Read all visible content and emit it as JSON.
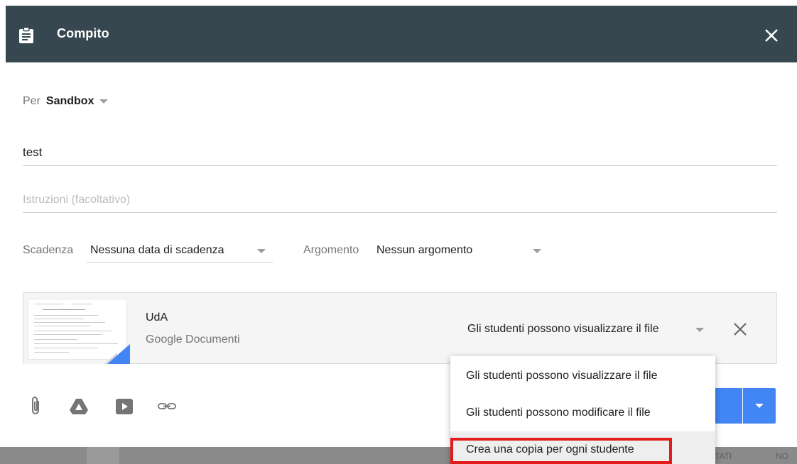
{
  "header": {
    "title": "Compito",
    "bg_color": "#37474f"
  },
  "form": {
    "for_label": "Per",
    "class_name": "Sandbox",
    "title_value": "test",
    "instructions_placeholder": "Istruzioni (facoltativo)",
    "due_label": "Scadenza",
    "due_value": "Nessuna data di scadenza",
    "topic_label": "Argomento",
    "topic_value": "Nessun argomento"
  },
  "attachment": {
    "name": "UdA",
    "type": "Google Documenti",
    "permission": "Gli studenti possono visualizzare il file"
  },
  "toolbar": {
    "icons": [
      "paperclip-icon",
      "drive-icon",
      "youtube-icon",
      "link-icon"
    ]
  },
  "dropdown": {
    "options": [
      "Gli studenti possono visualizzare il file",
      "Gli studenti possono modificare il file",
      "Crea una copia per ogni studente"
    ],
    "highlighted_index": 2,
    "highlight_color": "#e31b1b"
  },
  "background": {
    "tab_partial_1": "ETATI",
    "tab_partial_2": "NO"
  },
  "colors": {
    "accent": "#4285f4"
  }
}
